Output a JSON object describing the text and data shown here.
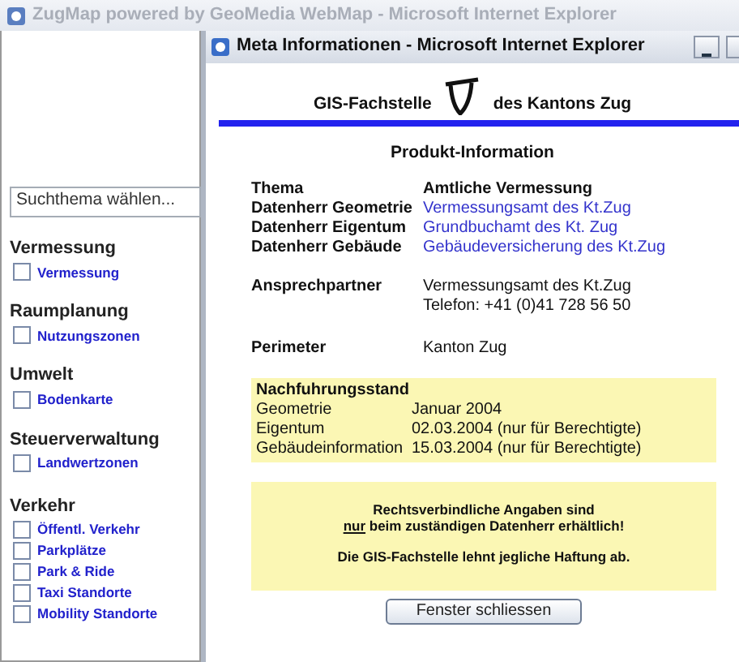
{
  "background_window": {
    "title": "ZugMap powered by GeoMedia WebMap - Microsoft Internet Explorer"
  },
  "sidebar": {
    "search_select": {
      "value": "Suchthema wählen..."
    },
    "groups": [
      {
        "title": "Vermessung",
        "items": [
          {
            "label": "Vermessung",
            "checked": false
          }
        ]
      },
      {
        "title": "Raumplanung",
        "items": [
          {
            "label": "Nutzungszonen",
            "checked": false
          }
        ]
      },
      {
        "title": "Umwelt",
        "items": [
          {
            "label": "Bodenkarte",
            "checked": false
          }
        ]
      },
      {
        "title": "Steuerverwaltung",
        "items": [
          {
            "label": "Landwertzonen",
            "checked": false
          }
        ]
      },
      {
        "title": "Verkehr",
        "items": [
          {
            "label": "Öffentl. Verkehr",
            "checked": false
          },
          {
            "label": "Parkplätze",
            "checked": false
          },
          {
            "label": "Park & Ride",
            "checked": false
          },
          {
            "label": "Taxi Standorte",
            "checked": false
          },
          {
            "label": "Mobility Standorte",
            "checked": false
          }
        ]
      }
    ]
  },
  "popup": {
    "title": "Meta Informationen - Microsoft Internet Explorer",
    "header_left": "GIS-Fachstelle",
    "header_right": "des Kantons Zug",
    "heading": "Produkt-Information",
    "info_rows": [
      {
        "label": "Thema",
        "values": [
          "Amtliche Vermessung"
        ],
        "kind": "bold"
      },
      {
        "label": "Datenherr Geometrie",
        "values": [
          "Vermessungsamt des Kt.Zug"
        ],
        "kind": "link"
      },
      {
        "label": "Datenherr Eigentum",
        "values": [
          "Grundbuchamt des Kt. Zug"
        ],
        "kind": "link"
      },
      {
        "label": "Datenherr Gebäude",
        "values": [
          "Gebäudeversicherung des Kt.Zug"
        ],
        "kind": "link"
      },
      {
        "label": "Ansprechpartner",
        "values": [
          "Vermessungsamt des Kt.Zug",
          "Telefon: +41 (0)41 728 56 50"
        ],
        "kind": "text"
      },
      {
        "label": "Perimeter",
        "values": [
          "Kanton Zug"
        ],
        "kind": "text"
      }
    ],
    "update": {
      "title": "Nachfuhrungsstand",
      "rows": [
        {
          "label": "Geometrie",
          "value": "Januar 2004"
        },
        {
          "label": "Eigentum",
          "value": "02.03.2004 (nur für Berechtigte)"
        },
        {
          "label": "Gebäudeinformation",
          "value": "15.03.2004 (nur für Berechtigte)"
        }
      ]
    },
    "notice": {
      "line_1": "Rechtsverbindliche Angaben sind",
      "line_2_underlined": "nur",
      "line_2_rest": " beim zuständigen Datenherr erhältlich!",
      "line_3": "Die GIS-Fachstelle lehnt jegliche Haftung ab."
    },
    "close_button": "Fenster schliessen"
  }
}
